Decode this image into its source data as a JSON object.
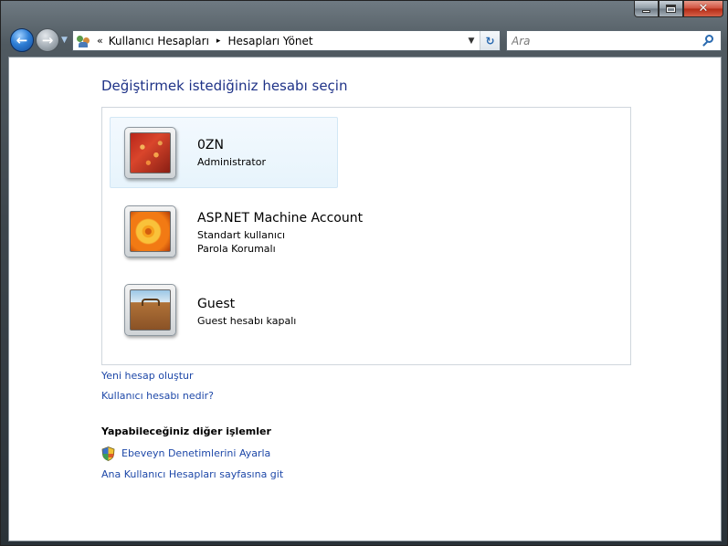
{
  "window": {
    "caption_buttons": {
      "minimize_icon": "minimize-icon",
      "maximize_icon": "maximize-icon",
      "close_icon": "close-icon",
      "close_glyph": "✕"
    }
  },
  "navigation": {
    "back_icon": "back-arrow-icon",
    "forward_icon": "forward-arrow-icon",
    "address": {
      "prefix": "«",
      "crumbs": [
        "Kullanıcı Hesapları",
        "Hesapları Yönet"
      ],
      "separator": "▸"
    },
    "search": {
      "placeholder": "Ara"
    }
  },
  "main": {
    "heading": "Değiştirmek istediğiniz hesabı seçin",
    "accounts": [
      {
        "name": "0ZN",
        "lines": [
          "Administrator"
        ],
        "picture": "coral-picture",
        "selected": true
      },
      {
        "name": "ASP.NET Machine Account",
        "lines": [
          "Standart kullanıcı",
          "Parola Korumalı"
        ],
        "picture": "flower-picture",
        "selected": false
      },
      {
        "name": "Guest",
        "lines": [
          "Guest hesabı kapalı"
        ],
        "picture": "suitcase-picture",
        "selected": false
      }
    ],
    "links": {
      "create_account": "Yeni hesap oluştur",
      "what_is_account": "Kullanıcı hesabı nedir?"
    },
    "other_tasks": {
      "title": "Yapabileceğiniz diğer işlemler",
      "parental_controls": "Ebeveyn Denetimlerini Ayarla",
      "main_page": "Ana Kullanıcı Hesapları sayfasına git"
    }
  },
  "colors": {
    "link": "#1e48a8",
    "heading": "#1e3287",
    "selected_bg": "#e7f4fc"
  }
}
